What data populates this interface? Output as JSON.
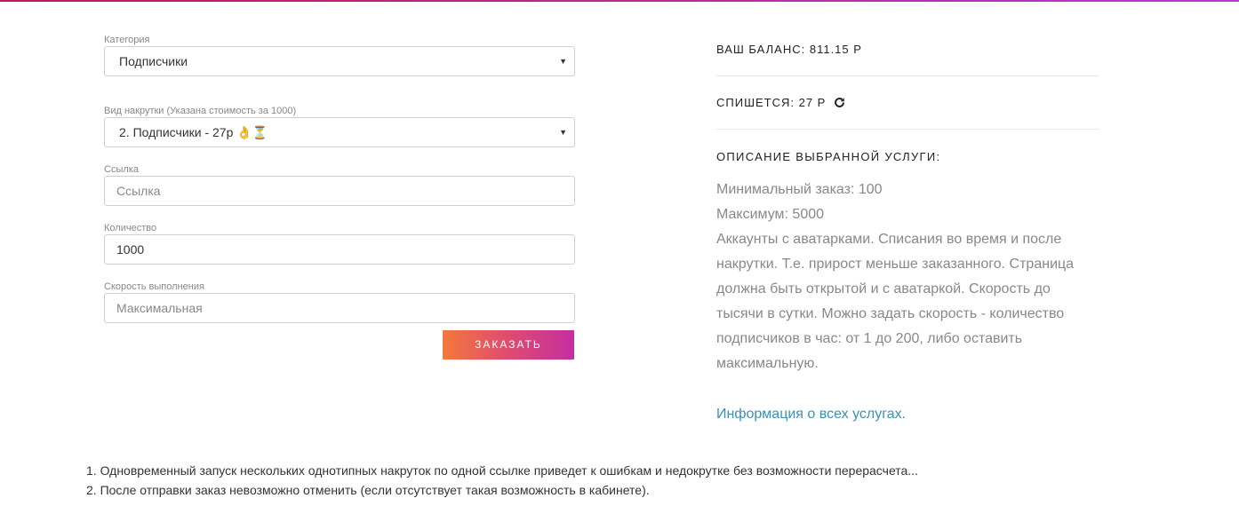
{
  "form": {
    "category": {
      "label": "Категория",
      "value": "Подписчики"
    },
    "service": {
      "label": "Вид накрутки (Указана стоимость за 1000)",
      "value": "2. Подписчики - 27р",
      "emoji": "👌⏳"
    },
    "link": {
      "label": "Ссылка",
      "placeholder": "Ссылка"
    },
    "quantity": {
      "label": "Количество",
      "value": "1000"
    },
    "speed": {
      "label": "Скорость выполнения",
      "placeholder": "Максимальная"
    },
    "submit_label": "ЗАКАЗАТЬ"
  },
  "summary": {
    "balance": "ВАШ БАЛАНС: 811.15 Р",
    "charge": "СПИШЕТСЯ: 27 Р",
    "description_title": "ОПИСАНИЕ ВЫБРАННОЙ УСЛУГИ:",
    "description_lines": [
      "Минимальный заказ: 100",
      "Максимум: 5000",
      "Аккаунты с аватарками. Списания во время и после",
      "накрутки. Т.е. прирост меньше заказанного. Страница",
      "должна быть открытой и с аватаркой. Скорость до",
      "тысячи в сутки. Можно задать скорость - количество",
      "подписчиков в час: от 1 до 200, либо оставить",
      "максимальную."
    ],
    "info_link": "Информация о всех услугах."
  },
  "notes": [
    "1. Одновременный запуск нескольких однотипных накруток по одной ссылке приведет к ошибкам и недокрутке без возможности перерасчета...",
    "2. После отправки заказ невозможно отменить (если отсутствует такая возможность в кабинете)."
  ],
  "colors": {
    "button_gradient_start": "#f3793b",
    "button_gradient_end": "#c42ea0",
    "link": "#3b8fb5"
  }
}
